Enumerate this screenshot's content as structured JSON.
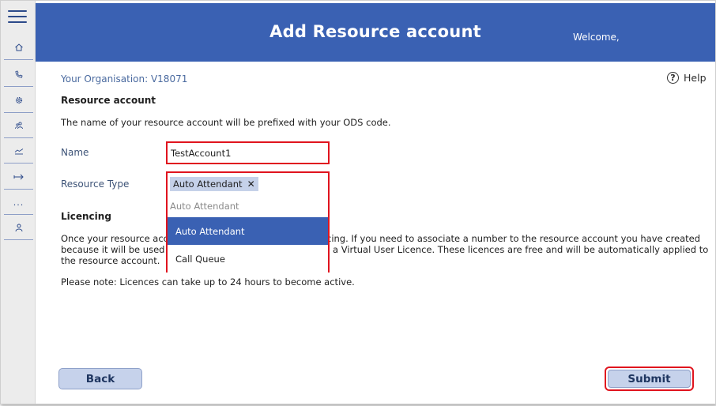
{
  "header": {
    "title": "Add Resource account",
    "welcome": "Welcome,"
  },
  "sidebar": {
    "menu_icon": "hamburger-menu-icon",
    "items": [
      {
        "icon": "home-icon"
      },
      {
        "icon": "phone-icon"
      },
      {
        "icon": "settings-icon"
      },
      {
        "icon": "users-icon"
      },
      {
        "icon": "chart-icon"
      },
      {
        "icon": "forward-arrow-icon"
      },
      {
        "icon": "more-icon",
        "glyph": "..."
      },
      {
        "icon": "user-icon"
      }
    ]
  },
  "organisation": "Your Organisation: V18071",
  "help_label": "Help",
  "resource_section": {
    "heading": "Resource account",
    "description": "The name of your resource account will be prefixed with your ODS code."
  },
  "form": {
    "name_label": "Name",
    "name_value": "TestAccount1",
    "resource_type_label": "Resource Type",
    "selected_chip": "Auto Attendant",
    "chip_remove": "✕",
    "search_placeholder": "Auto Attendant",
    "options": [
      "Auto Attendant",
      "Call Queue"
    ]
  },
  "licencing": {
    "heading": "Licencing",
    "line1_left": "Once your resource acco",
    "line1_right": "cing. If you need to associate a number to the resource account you have created",
    "line2_left": "because it will be used fo",
    "line2_right": "a Virtual User Licence. These licences are free and will be automatically applied to",
    "line3": "the resource account.",
    "note": "Please note: Licences can take up to 24 hours to become active."
  },
  "buttons": {
    "back": "Back",
    "submit": "Submit"
  },
  "colors": {
    "header": "#3a61b3",
    "highlight": "#e0141e",
    "button_bg": "#c6d2eb",
    "selected_option": "#3a61b3"
  }
}
